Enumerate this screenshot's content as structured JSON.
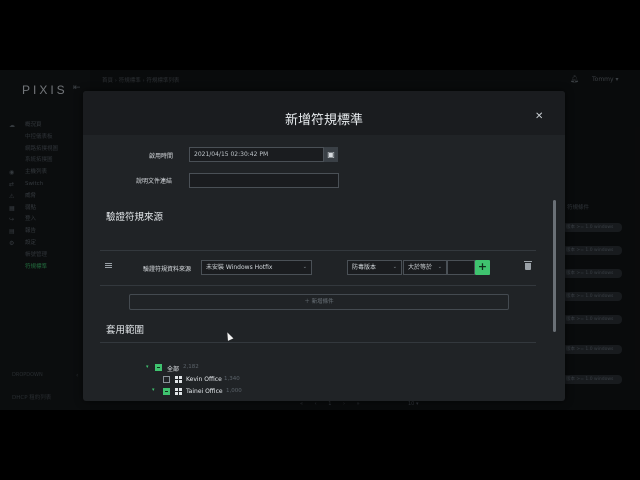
{
  "app": {
    "logo": "PIXIS",
    "breadcrumb": "首頁 › 符規標準 › 符規標準列表",
    "user": "Tommy ▾"
  },
  "sidebar": {
    "items": [
      {
        "icon": "cloud-icon",
        "label": "概況頁"
      },
      {
        "icon": "",
        "label": "中控儀表板"
      },
      {
        "icon": "",
        "label": "網路拓撲視圖"
      },
      {
        "icon": "",
        "label": "系統拓撲圖"
      },
      {
        "icon": "users-icon",
        "label": "主機列表"
      },
      {
        "icon": "switch-icon",
        "label": "Switch"
      },
      {
        "icon": "alert-icon",
        "label": "威脅"
      },
      {
        "icon": "bug-icon",
        "label": "弱點"
      },
      {
        "icon": "login-icon",
        "label": "登入"
      },
      {
        "icon": "report-icon",
        "label": "報告"
      },
      {
        "icon": "gear-icon",
        "label": "設定"
      },
      {
        "icon": "",
        "label": "帳號管理"
      },
      {
        "icon": "",
        "label": "符規標準"
      }
    ],
    "footer1": "DROPDOWN",
    "footer2": "DHCP 租約列表"
  },
  "background": {
    "column_header": "符規條件",
    "tags": [
      "版本 >= 1.0 windows",
      "版本 >= 1.0 windows",
      "版本 >= 1.0 windows",
      "版本 >= 1.0 windows",
      "版本 >= 1.0 windows",
      "版本 >= 1.0 windows",
      "版本 >= 1.0 windows",
      "版本 >= 1.0 windows"
    ],
    "pager": "« ‹ 1 › »",
    "page_size": "10 ▾"
  },
  "modal": {
    "title": "新增符規標準",
    "enable_time_label": "啟用時間",
    "enable_time_value": "2021/04/15 02:30:42 PM",
    "doc_link_label": "說明文件連結",
    "doc_link_value": "",
    "section_source": "驗證符規來源",
    "source_label": "驗證符規資料來源",
    "source_value": "未安裝 Windows Hotfix",
    "field_select": "防毒版本",
    "operator_select": "大於等於",
    "value_input": "",
    "add_condition": "＋ 新增條件",
    "section_scope": "套用範圍",
    "tree": [
      {
        "label": "全部",
        "count": "2,182"
      },
      {
        "label": "Kevin Office",
        "count": "1,340"
      },
      {
        "label": "Tainei Office",
        "count": "1,000"
      }
    ]
  }
}
